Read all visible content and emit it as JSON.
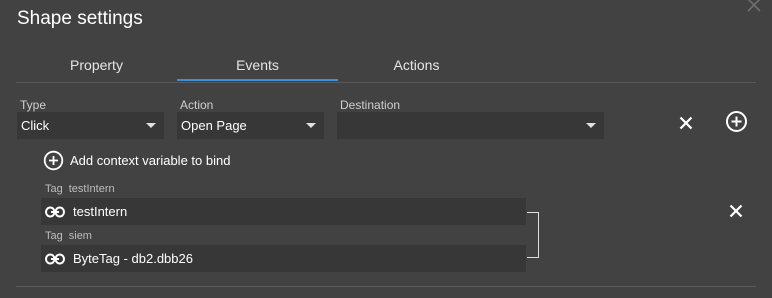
{
  "dialog": {
    "title": "Shape settings"
  },
  "tabs": [
    {
      "label": "Property",
      "active": false
    },
    {
      "label": "Events",
      "active": true
    },
    {
      "label": "Actions",
      "active": false
    }
  ],
  "event_row": {
    "type": {
      "label": "Type",
      "value": "Click"
    },
    "action": {
      "label": "Action",
      "value": "Open Page"
    },
    "destination": {
      "label": "Destination",
      "value": ""
    }
  },
  "context": {
    "add_label": "Add context variable to bind",
    "tags": [
      {
        "prefix": "Tag",
        "name": "testIntern",
        "value": "testIntern"
      },
      {
        "prefix": "Tag",
        "name": "siem",
        "value": "ByteTag - db2.dbb26"
      }
    ]
  },
  "colors": {
    "background": "#424242",
    "field": "#373737",
    "accent": "#3e8ed8"
  },
  "icons": [
    "close-icon",
    "remove-icon",
    "add-circle-icon",
    "link-icon"
  ]
}
